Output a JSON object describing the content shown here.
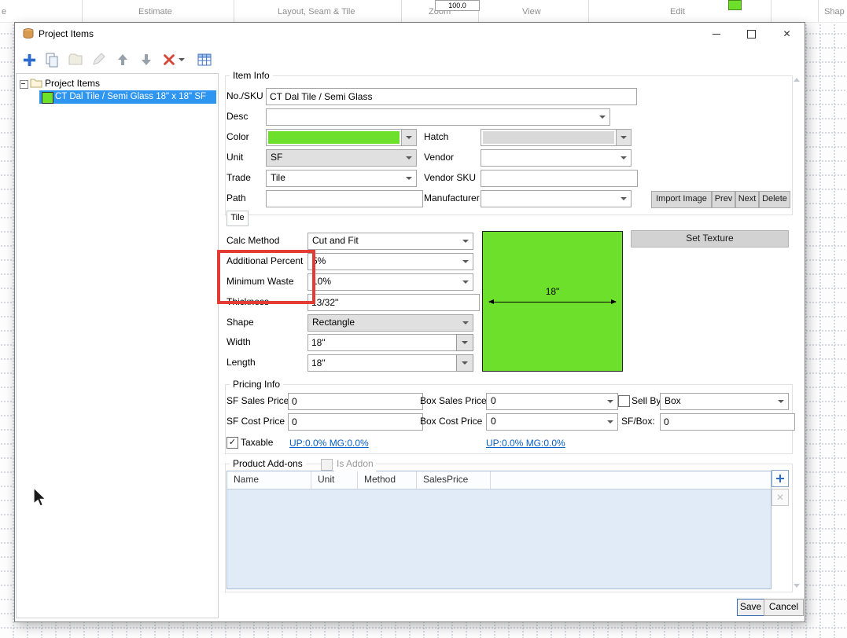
{
  "ribbon": {
    "clip_left": "e",
    "zoom_value": "100.0",
    "groups": {
      "estimate": "Estimate",
      "layout": "Layout, Seam & Tile",
      "zoom": "Zoom",
      "view": "View",
      "edit": "Edit",
      "shape_clip": "Shap"
    }
  },
  "icons": {
    "close": "✕",
    "check": "✓"
  },
  "dialog": {
    "title": "Project Items",
    "tree": {
      "root_label": "Project Items",
      "item_label": "CT Dal Tile / Semi Glass 18\" x 18\" SF"
    },
    "item_info": {
      "title": "Item Info",
      "no_sku": {
        "label": "No./SKU",
        "value": "CT Dal Tile / Semi Glass"
      },
      "desc": {
        "label": "Desc",
        "value": ""
      },
      "color": {
        "label": "Color"
      },
      "hatch": {
        "label": "Hatch"
      },
      "unit": {
        "label": "Unit",
        "value": "SF"
      },
      "vendor": {
        "label": "Vendor",
        "value": ""
      },
      "trade": {
        "label": "Trade",
        "value": "Tile"
      },
      "vendor_sku": {
        "label": "Vendor SKU",
        "value": ""
      },
      "path": {
        "label": "Path",
        "value": ""
      },
      "manufacturer": {
        "label": "Manufacturer",
        "value": ""
      },
      "import_image": "Import Image",
      "prev": "Prev",
      "next": "Next",
      "delete": "Delete"
    },
    "tile": {
      "tab": "Tile",
      "calc_method": {
        "label": "Calc Method",
        "value": "Cut and Fit"
      },
      "additional_percent": {
        "label": "Additional Percent",
        "value": "5%"
      },
      "minimum_waste": {
        "label": "Minimum Waste",
        "value": "10%"
      },
      "thickness": {
        "label": "Thickness",
        "value": "13/32\""
      },
      "shape": {
        "label": "Shape",
        "value": "Rectangle"
      },
      "width": {
        "label": "Width",
        "value": "18\""
      },
      "length": {
        "label": "Length",
        "value": "18\""
      },
      "preview_dimension": "18\"",
      "set_texture": "Set Texture"
    },
    "pricing": {
      "title": "Pricing Info",
      "sf_sales": {
        "label": "SF Sales Price",
        "value": "0"
      },
      "box_sales": {
        "label": "Box Sales Price",
        "value": "0"
      },
      "sell_by": {
        "label": "Sell By",
        "value": "Box"
      },
      "sf_cost": {
        "label": "SF Cost Price",
        "value": "0"
      },
      "box_cost": {
        "label": "Box Cost Price",
        "value": "0"
      },
      "sf_box": {
        "label": "SF/Box:",
        "value": "0"
      },
      "taxable": "Taxable",
      "margin_left": "UP:0.0% MG:0.0%",
      "margin_right": "UP:0.0% MG:0.0%"
    },
    "addons": {
      "title": "Product Add-ons",
      "is_addon": "Is Addon",
      "columns": [
        "Name",
        "Unit",
        "Method",
        "SalesPrice"
      ]
    },
    "save": "Save",
    "cancel": "Cancel"
  },
  "colors": {
    "tile_green": "#6de02b",
    "selection_blue": "#2e95f0",
    "annotation_red": "#e23c34",
    "link_blue": "#0b5fc0"
  }
}
